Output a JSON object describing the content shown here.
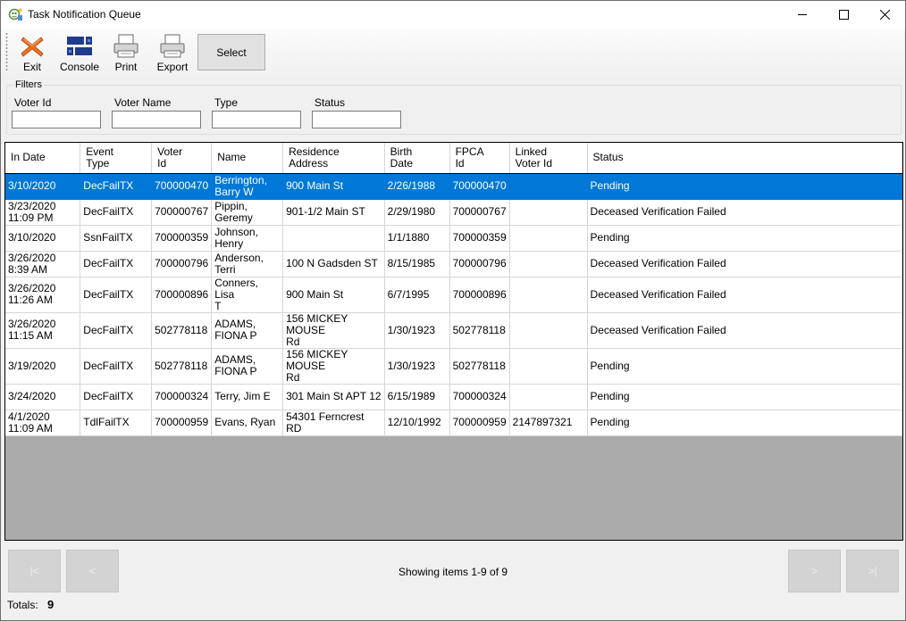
{
  "window": {
    "title": "Task Notification Queue"
  },
  "toolbar": {
    "exit_label": "Exit",
    "console_label": "Console",
    "print_label": "Print",
    "export_label": "Export",
    "select_label": "Select"
  },
  "filters": {
    "legend": "Filters",
    "voter_id_label": "Voter Id",
    "voter_name_label": "Voter Name",
    "type_label": "Type",
    "status_label": "Status",
    "voter_id_value": "",
    "voter_name_value": "",
    "type_value": "",
    "status_value": ""
  },
  "grid": {
    "columns": [
      {
        "l1": "In Date",
        "l2": ""
      },
      {
        "l1": "Event",
        "l2": "Type"
      },
      {
        "l1": "Voter",
        "l2": "Id"
      },
      {
        "l1": "Name",
        "l2": ""
      },
      {
        "l1": "Residence",
        "l2": "Address"
      },
      {
        "l1": "Birth",
        "l2": "Date"
      },
      {
        "l1": "FPCA",
        "l2": "Id"
      },
      {
        "l1": "Linked",
        "l2": "Voter Id"
      },
      {
        "l1": "Status",
        "l2": ""
      }
    ],
    "rows": [
      {
        "in_date_1": "3/10/2020",
        "in_date_2": "",
        "event_type": "DecFailTX",
        "voter_id": "700000470",
        "name_1": "Berrington,",
        "name_2": "Barry W",
        "address_1": "900 Main St",
        "address_2": "",
        "birth_date": "2/26/1988",
        "fpca_id": "700000470",
        "linked_voter_id": "",
        "status": "Pending"
      },
      {
        "in_date_1": "3/23/2020",
        "in_date_2": "11:09 PM",
        "event_type": "DecFailTX",
        "voter_id": "700000767",
        "name_1": "Pippin, Geremy",
        "name_2": "",
        "address_1": "901-1/2 Main ST",
        "address_2": "",
        "birth_date": "2/29/1980",
        "fpca_id": "700000767",
        "linked_voter_id": "",
        "status": "Deceased Verification Failed"
      },
      {
        "in_date_1": "3/10/2020",
        "in_date_2": "",
        "event_type": "SsnFailTX",
        "voter_id": "700000359",
        "name_1": "Johnson,",
        "name_2": "Henry",
        "address_1": "",
        "address_2": "",
        "birth_date": "1/1/1880",
        "fpca_id": "700000359",
        "linked_voter_id": "",
        "status": "Pending"
      },
      {
        "in_date_1": "3/26/2020",
        "in_date_2": "8:39 AM",
        "event_type": "DecFailTX",
        "voter_id": "700000796",
        "name_1": "Anderson, Terri",
        "name_2": "",
        "address_1": "100 N Gadsden ST",
        "address_2": "",
        "birth_date": "8/15/1985",
        "fpca_id": "700000796",
        "linked_voter_id": "",
        "status": "Deceased Verification Failed"
      },
      {
        "in_date_1": "3/26/2020",
        "in_date_2": "11:26 AM",
        "event_type": "DecFailTX",
        "voter_id": "700000896",
        "name_1": "Conners, Lisa",
        "name_2": "T",
        "address_1": "900 Main St",
        "address_2": "",
        "birth_date": "6/7/1995",
        "fpca_id": "700000896",
        "linked_voter_id": "",
        "status": "Deceased Verification Failed"
      },
      {
        "in_date_1": "3/26/2020",
        "in_date_2": "11:15 AM",
        "event_type": "DecFailTX",
        "voter_id": "502778118",
        "name_1": "ADAMS,",
        "name_2": "FIONA P",
        "address_1": "156 MICKEY MOUSE",
        "address_2": "Rd",
        "birth_date": "1/30/1923",
        "fpca_id": "502778118",
        "linked_voter_id": "",
        "status": "Deceased Verification Failed"
      },
      {
        "in_date_1": "3/19/2020",
        "in_date_2": "",
        "event_type": "DecFailTX",
        "voter_id": "502778118",
        "name_1": "ADAMS,",
        "name_2": "FIONA P",
        "address_1": "156 MICKEY MOUSE",
        "address_2": "Rd",
        "birth_date": "1/30/1923",
        "fpca_id": "502778118",
        "linked_voter_id": "",
        "status": "Pending"
      },
      {
        "in_date_1": "3/24/2020",
        "in_date_2": "",
        "event_type": "DecFailTX",
        "voter_id": "700000324",
        "name_1": "Terry, Jim E",
        "name_2": "",
        "address_1": "301 Main St APT 12",
        "address_2": "",
        "birth_date": "6/15/1989",
        "fpca_id": "700000324",
        "linked_voter_id": "",
        "status": "Pending"
      },
      {
        "in_date_1": "4/1/2020",
        "in_date_2": "11:09 AM",
        "event_type": "TdlFailTX",
        "voter_id": "700000959",
        "name_1": "Evans, Ryan",
        "name_2": "",
        "address_1": "54301 Ferncrest RD",
        "address_2": "",
        "birth_date": "12/10/1992",
        "fpca_id": "700000959",
        "linked_voter_id": "2147897321",
        "status": "Pending"
      }
    ]
  },
  "footer": {
    "first_label": "|<",
    "prev_label": "<",
    "next_label": ">",
    "last_label": ">|",
    "showing_text": "Showing items 1-9 of 9",
    "totals_label": "Totals:",
    "totals_value": "9"
  },
  "colors": {
    "selection": "#0078d7",
    "grid_background": "#ababab",
    "exit_icon": "#e8711f",
    "console_icon": "#1f3b8c"
  }
}
